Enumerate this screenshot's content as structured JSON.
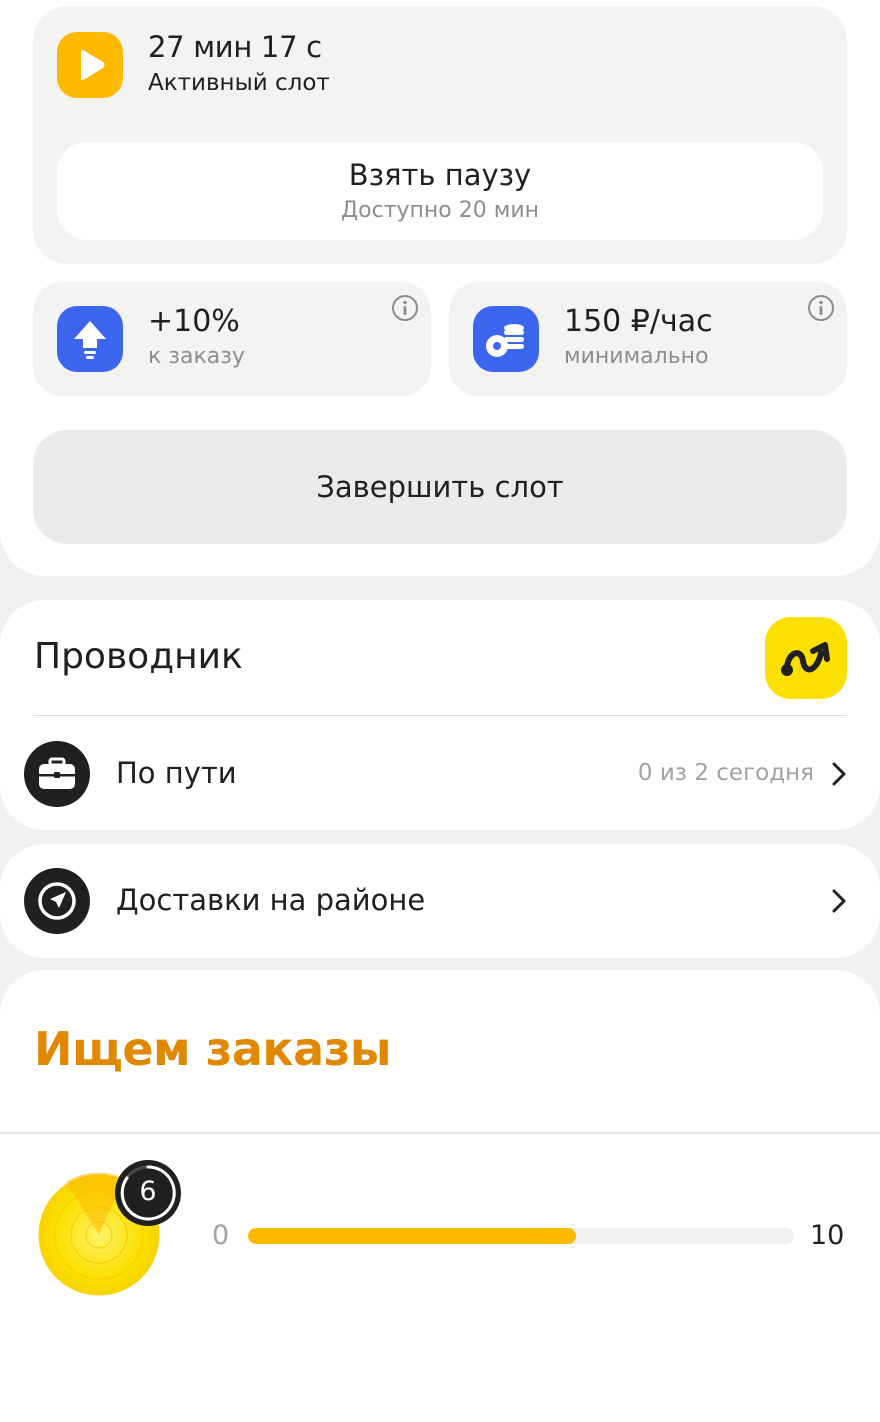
{
  "slot": {
    "time": "27 мин 17 с",
    "label": "Активный слот",
    "icon": "play-icon",
    "accent": "#fcb900"
  },
  "pause": {
    "title": "Взять паузу",
    "subtitle": "Доступно 20 мин"
  },
  "stats": [
    {
      "value": "+10%",
      "subtitle": "к заказу",
      "icon": "arrow-up-icon",
      "color": "#3d66f0"
    },
    {
      "value": "150 ₽/час",
      "subtitle": "минимально",
      "icon": "coins-icon",
      "color": "#3d66f0"
    }
  ],
  "finish": {
    "label": "Завершить слот"
  },
  "guide": {
    "title": "Проводник",
    "badge_icon": "route-icon",
    "badge_color": "#fce000",
    "rows": [
      {
        "label": "По пути",
        "meta": "0 из 2 сегодня",
        "icon": "briefcase-icon"
      }
    ]
  },
  "district": {
    "label": "Доставки на районе",
    "icon": "navigation-icon"
  },
  "search": {
    "title": "Ищем заказы",
    "title_color": "#e08900",
    "count": "6",
    "progress_min": "0",
    "progress_max": "10",
    "progress_value": 6
  }
}
